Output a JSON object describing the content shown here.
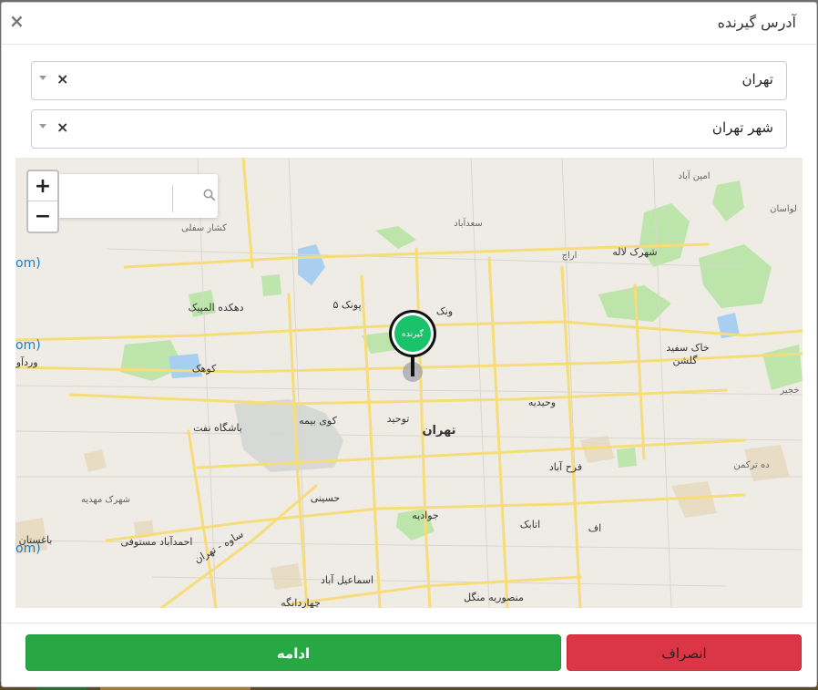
{
  "dialog": {
    "title": "آدرس گیرنده",
    "close_symbol": "×"
  },
  "province_select": {
    "value": "تهران",
    "clear_symbol": "×"
  },
  "city_select": {
    "value": "شهر تهران",
    "clear_symbol": "×"
  },
  "map": {
    "zoom_in": "+",
    "zoom_out": "−",
    "marker_label": "گیرنده",
    "edge_labels": [
      "om)",
      "om)",
      "om)"
    ],
    "place_labels": [
      "امین آباد",
      "سعدآباد",
      "لواسان",
      "کشار سفلی",
      "شهرک لاله",
      "اراج",
      "دهکده المپیک",
      "پونک ۵",
      "ونک",
      "خاک سفید",
      "گلشن",
      "کوهک",
      "کوی بیمه",
      "باشگاه نفت",
      "توحید",
      "تهران",
      "وحیدیه",
      "فرح آباد",
      "ده ترکمن",
      "شهرک مهدیه",
      "حسینی",
      "جوادیه",
      "اتابک",
      "احمدآباد مستوفی",
      "ساوه - تهران",
      "اسماعیل آباد",
      "منصوریه منگل",
      "چهاردانگه",
      "باغستان",
      "خجیر",
      "وردآور"
    ]
  },
  "footer": {
    "cancel_label": "انصراف",
    "continue_label": "ادامه"
  },
  "colors": {
    "cancel": "#dc3545",
    "continue": "#28a745",
    "marker": "#19c26b"
  }
}
